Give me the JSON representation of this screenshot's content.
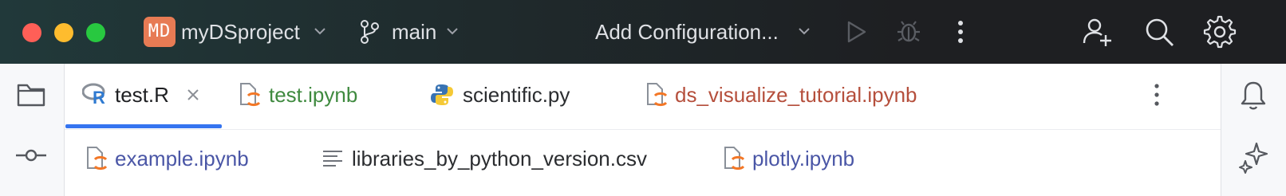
{
  "titlebar": {
    "project_badge": "MD",
    "project_name": "myDSproject",
    "branch": "main",
    "run_config": "Add Configuration...",
    "icons": [
      "folder-icon",
      "branch-icon",
      "run-icon",
      "debug-icon",
      "more-vertical-icon",
      "add-user-icon",
      "search-icon",
      "settings-icon"
    ]
  },
  "colors": {
    "accent": "#3574f0",
    "ipynb_green": "#3f8a3f",
    "ipynb_red": "#b54f3c",
    "ipynb_blue": "#4a56a6",
    "text": "#2b2d30"
  },
  "tabs": {
    "row1": [
      {
        "label": "test.R",
        "active": true,
        "icon": "r-file-icon"
      },
      {
        "label": "test.ipynb",
        "icon": "jupyter-file-icon"
      },
      {
        "label": "scientific.py",
        "icon": "python-file-icon"
      },
      {
        "label": "ds_visualize_tutorial.ipynb",
        "icon": "jupyter-file-icon"
      }
    ],
    "row2": [
      {
        "label": "example.ipynb",
        "icon": "jupyter-file-icon"
      },
      {
        "label": "libraries_by_python_version.csv",
        "icon": "text-file-icon"
      },
      {
        "label": "plotly.ipynb",
        "icon": "jupyter-file-icon"
      }
    ]
  }
}
